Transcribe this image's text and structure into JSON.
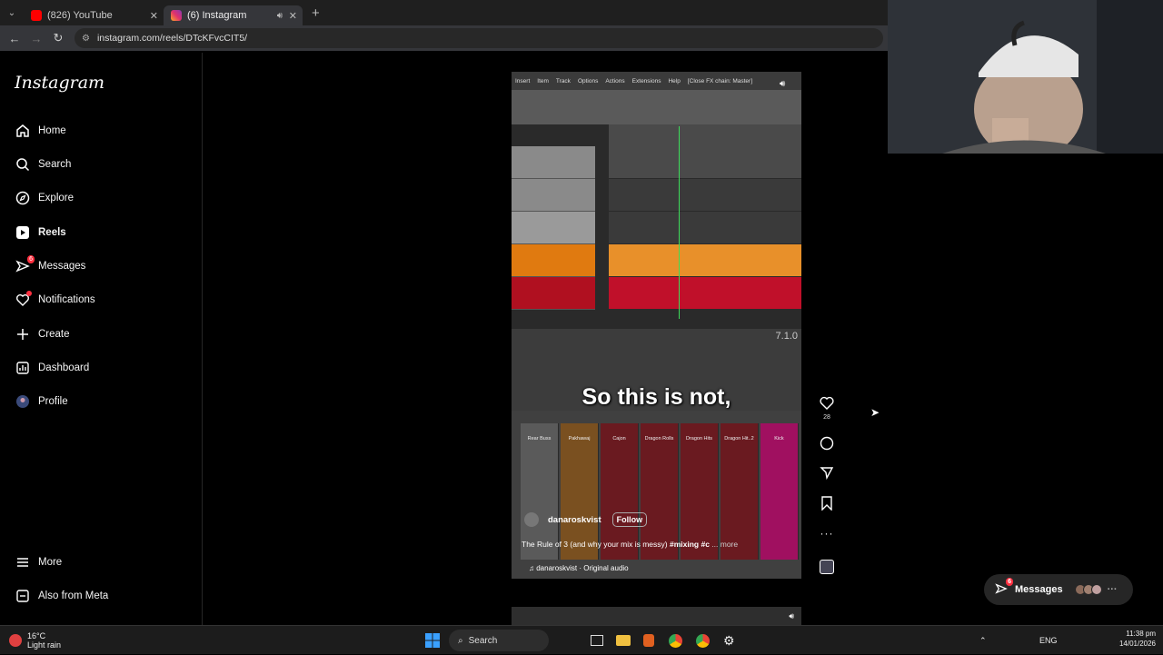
{
  "browser": {
    "tabs": [
      {
        "label": "(826) YouTube",
        "color": "#ff0000"
      },
      {
        "label": "(6) Instagram",
        "color": "#e1306c"
      }
    ],
    "url": "instagram.com/reels/DTcKFvcCIT5/"
  },
  "sidebar": {
    "logo": "Instagram",
    "items": [
      {
        "label": "Home",
        "icon": "home-icon"
      },
      {
        "label": "Search",
        "icon": "search-icon"
      },
      {
        "label": "Explore",
        "icon": "compass-icon"
      },
      {
        "label": "Reels",
        "icon": "reels-icon"
      },
      {
        "label": "Messages",
        "icon": "messenger-icon",
        "badge": "6"
      },
      {
        "label": "Notifications",
        "icon": "heart-icon"
      },
      {
        "label": "Create",
        "icon": "plus-icon"
      },
      {
        "label": "Dashboard",
        "icon": "dashboard-icon"
      },
      {
        "label": "Profile",
        "icon": "profile-avatar"
      }
    ],
    "bottom": [
      {
        "label": "More",
        "icon": "hamburger-icon"
      },
      {
        "label": "Also from Meta",
        "icon": "meta-icon"
      }
    ]
  },
  "reel": {
    "daw_menu": [
      "Insert",
      "Item",
      "Track",
      "Options",
      "Actions",
      "Extensions",
      "Help",
      "[Close FX chain: Master]"
    ],
    "caption": "So this is not,",
    "username": "danaroskvist",
    "follow": "Follow",
    "description_prefix": "The Rule of 3 (and why your mix is messy)",
    "description_tags": "#mixing #c",
    "description_more": "... more",
    "audio": "danaroskvist · Original audio",
    "mixer_strips": [
      "Rear Buss",
      "Pakhawaj",
      "Cajon",
      "Dragon Rolls",
      "Dragon Hits",
      "Dragon Hit..2",
      "Kick"
    ],
    "daw_time": "7.1.0"
  },
  "actions": {
    "likes": "28"
  },
  "messages_pill": {
    "label": "Messages",
    "badge": "6"
  },
  "taskbar": {
    "weather_temp": "16°C",
    "weather_desc": "Light rain",
    "search": "Search",
    "lang": "ENG",
    "time": "11:38 pm",
    "date": "14/01/2026"
  }
}
